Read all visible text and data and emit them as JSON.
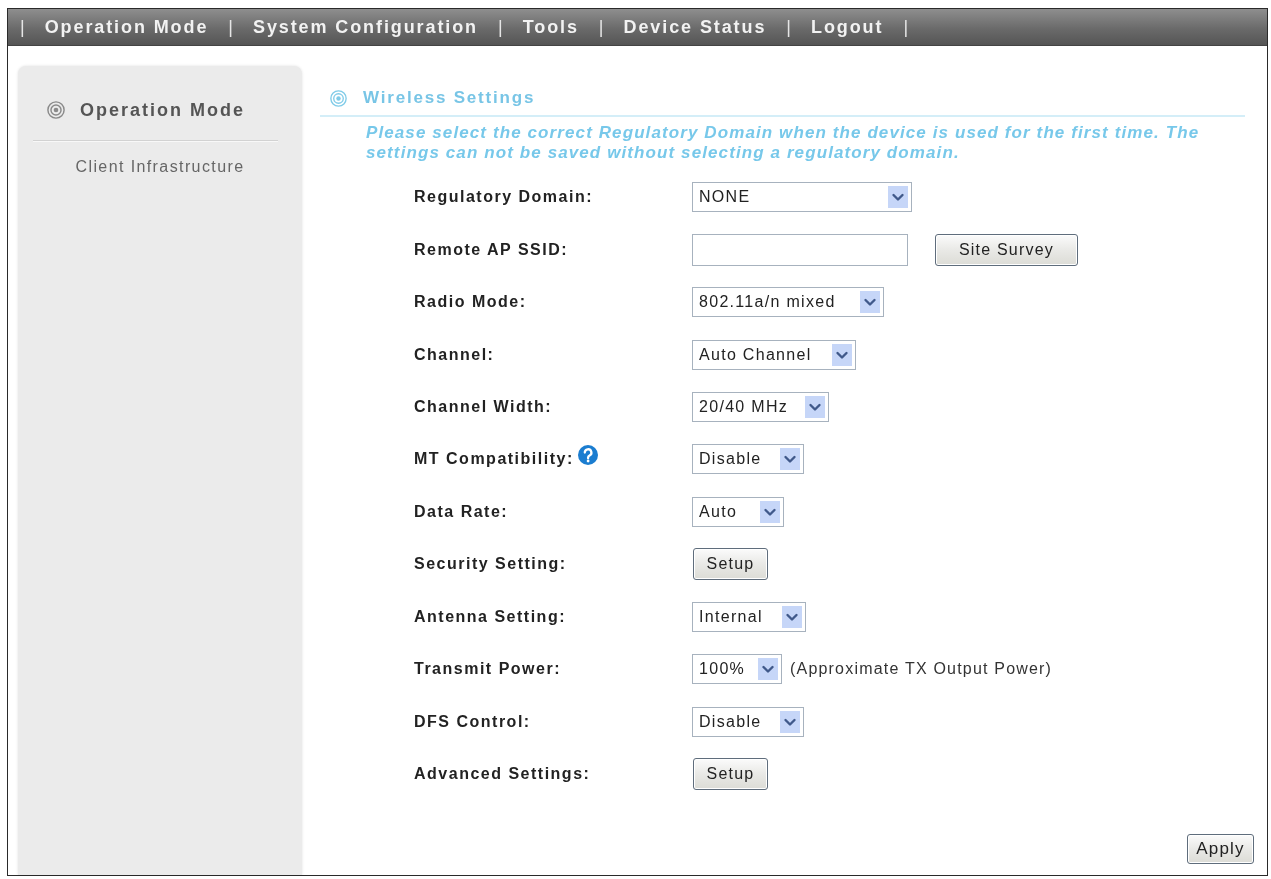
{
  "nav": [
    {
      "kind": "separator",
      "text": "|"
    },
    {
      "kind": "link",
      "text": "Operation Mode"
    },
    {
      "kind": "separator",
      "text": "|"
    },
    {
      "kind": "link",
      "text": "System Configuration"
    },
    {
      "kind": "separator",
      "text": "|"
    },
    {
      "kind": "link",
      "text": "Tools"
    },
    {
      "kind": "separator",
      "text": "|"
    },
    {
      "kind": "link",
      "text": "Device Status"
    },
    {
      "kind": "separator",
      "text": "|"
    },
    {
      "kind": "link",
      "text": "Logout"
    },
    {
      "kind": "separator",
      "text": "|"
    }
  ],
  "sidebar": {
    "title": "Operation Mode",
    "items": [
      {
        "label": "Client Infrastructure"
      }
    ]
  },
  "section": {
    "title": "Wireless Settings",
    "note": "Please select the correct Regulatory Domain when the device is used for the first time. The settings can not be saved without selecting a regulatory domain."
  },
  "form": {
    "rows": [
      {
        "label": "Regulatory Domain:",
        "kind": "select",
        "value": "NONE",
        "help": false
      },
      {
        "label": "Remote AP SSID:",
        "kind": "input",
        "button": "Site Survey",
        "help": false
      },
      {
        "label": "Radio Mode:",
        "kind": "select",
        "value": "802.11a/n mixed",
        "help": false
      },
      {
        "label": "Channel:",
        "kind": "select",
        "value": "Auto Channel",
        "help": false
      },
      {
        "label": "Channel Width:",
        "kind": "select",
        "value": "20/40 MHz",
        "help": false
      },
      {
        "label": "MT Compatibility:",
        "kind": "select",
        "value": "Disable",
        "help": true
      },
      {
        "label": "Data Rate:",
        "kind": "select",
        "value": "Auto",
        "help": false
      },
      {
        "label": "Security Setting:",
        "kind": "button",
        "button": "Setup",
        "help": false
      },
      {
        "label": "Antenna Setting:",
        "kind": "select",
        "value": "Internal",
        "help": false
      },
      {
        "label": "Transmit Power:",
        "kind": "select",
        "value": "100%",
        "note": "(Approximate TX Output Power)",
        "help": false
      },
      {
        "label": "DFS Control:",
        "kind": "select",
        "value": "Disable",
        "help": false
      },
      {
        "label": "Advanced Settings:",
        "kind": "button",
        "button": "Setup",
        "help": false
      }
    ]
  },
  "apply_button": "Apply"
}
